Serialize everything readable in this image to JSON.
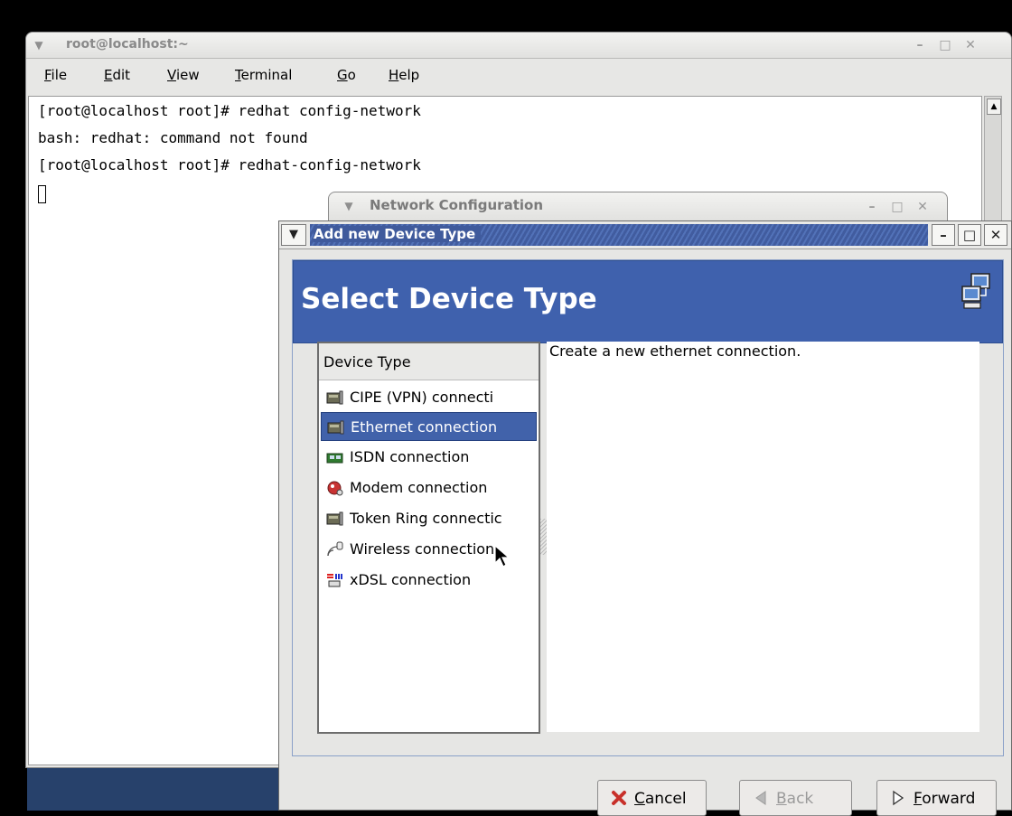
{
  "terminal": {
    "title": "root@localhost:~",
    "menu": [
      {
        "label": "File",
        "mnemonic": "F",
        "rest": "ile"
      },
      {
        "label": "Edit",
        "mnemonic": "E",
        "rest": "dit"
      },
      {
        "label": "View",
        "mnemonic": "V",
        "rest": "iew"
      },
      {
        "label": "Terminal",
        "mnemonic": "T",
        "rest": "erminal"
      },
      {
        "label": "Go",
        "mnemonic": "G",
        "rest": "o"
      },
      {
        "label": "Help",
        "mnemonic": "H",
        "rest": "elp"
      }
    ],
    "lines": [
      "[root@localhost root]# redhat config-network",
      "bash: redhat: command not found",
      "[root@localhost root]# redhat-config-network"
    ]
  },
  "network_config_window": {
    "title": "Network Configuration"
  },
  "dialog": {
    "title": "Add new Device Type",
    "banner_title": "Select Device Type",
    "list_header": "Device Type",
    "device_types": [
      {
        "label": "CIPE (VPN) connecti",
        "icon": "network-card-icon",
        "selected": false
      },
      {
        "label": "Ethernet connection",
        "icon": "network-card-icon",
        "selected": true
      },
      {
        "label": "ISDN connection",
        "icon": "isdn-card-icon",
        "selected": false
      },
      {
        "label": "Modem connection",
        "icon": "modem-icon",
        "selected": false
      },
      {
        "label": "Token Ring connectic",
        "icon": "network-card-icon",
        "selected": false
      },
      {
        "label": "Wireless connection",
        "icon": "wireless-icon",
        "selected": false
      },
      {
        "label": "xDSL connection",
        "icon": "dsl-icon",
        "selected": false
      }
    ],
    "description": "Create a new ethernet connection.",
    "buttons": {
      "cancel": {
        "label": "Cancel",
        "mnemonic": "C",
        "rest": "ancel"
      },
      "back": {
        "label": "Back",
        "mnemonic": "B",
        "rest": "ack"
      },
      "forward": {
        "label": "Forward",
        "mnemonic": "F",
        "rest": "orward"
      }
    }
  },
  "colors": {
    "banner": "#3f61ad",
    "selection": "#4162aa",
    "desktop": "#000000"
  }
}
